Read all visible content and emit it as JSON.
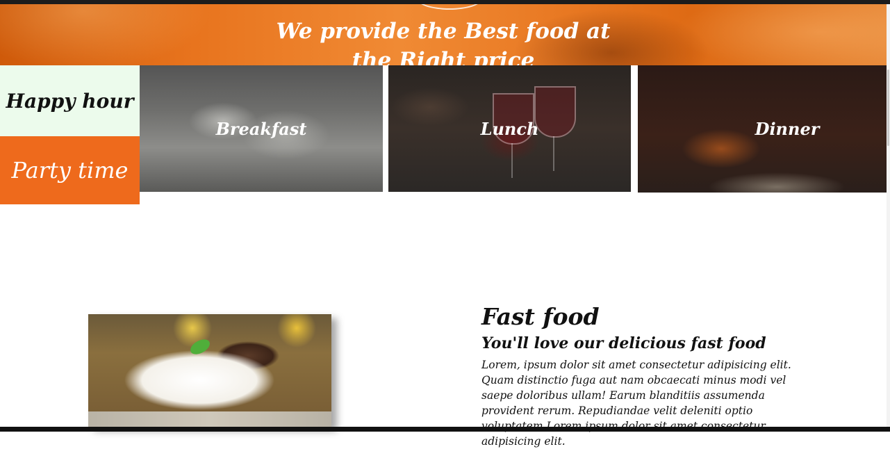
{
  "hero": {
    "line1": "We provide the Best food at",
    "line2_prefix": "the ",
    "line2_bold": "Right price"
  },
  "sidebar": {
    "items": [
      {
        "label": "Happy hour"
      },
      {
        "label": "Party time"
      }
    ]
  },
  "meals": [
    {
      "label": "Breakfast"
    },
    {
      "label": "Lunch"
    },
    {
      "label": "Dinner"
    }
  ],
  "feature": {
    "title": "Fast food",
    "subtitle": "You'll love our delicious fast food",
    "body": "Lorem, ipsum dolor sit amet consectetur adipisicing elit. Quam distinctio fuga aut nam obcaecati minus modi vel saepe doloribus ullam! Earum blanditiis assumenda provident rerum. Repudiandae velit deleniti optio voluptatem Lorem ipsum dolor sit amet consectetur adipisicing elit."
  },
  "colors": {
    "accent_orange": "#ee6a1c",
    "happy_bg": "#ecfbec"
  }
}
